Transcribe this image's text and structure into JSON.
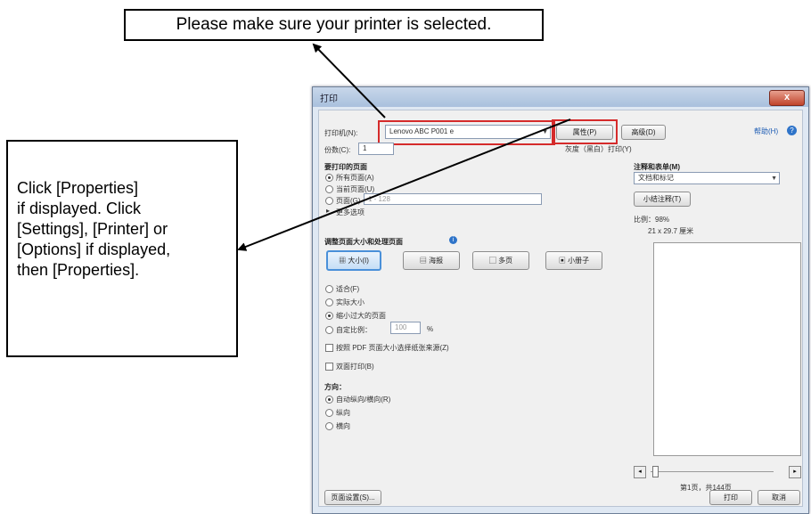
{
  "callouts": {
    "top": "Please make sure your printer is selected.",
    "left_lines": [
      "Click [Properties]",
      "if displayed. Click",
      "[Settings], [Printer] or",
      "[Options] if displayed,",
      "then [Properties]."
    ]
  },
  "dialog": {
    "title": "打印",
    "close_label": "x",
    "printer_label": "打印机(N):",
    "printer_value": "Lenovo ABC P001 e",
    "properties_button": "属性(P)",
    "advanced_button": "高级(D)",
    "help_link": "帮助(H)",
    "copies_label": "份数(C):",
    "copies_value": "1",
    "grayscale_label": "灰度（黑白）打印(Y)",
    "pages_section": "要打印的页面",
    "pages_options": [
      "所有页面(A)",
      "当前页面(U)",
      "页面(G)",
      "更多选项"
    ],
    "pages_range": "1 - 128",
    "size_section": "调整页面大小和处理页面",
    "mode_buttons": [
      "大小(I)",
      "海报",
      "多页",
      "小册子"
    ],
    "size_options": [
      "适合(F)",
      "实际大小",
      "缩小过大的页面",
      "自定比例："
    ],
    "scale_value": "100",
    "scale_unit": "%",
    "pdf_paper_check": "按照 PDF 页面大小选择纸张来源(Z)",
    "duplex_check": "双面打印(B)",
    "orientation_label": "方向：",
    "orientation_options": [
      "自动纵向/横向(R)",
      "纵向",
      "横向"
    ],
    "comments_label": "注释和表单(M)",
    "comments_value": "文档和标记",
    "summary_button": "小结注释(T)",
    "scale_text": "比例：98%",
    "size_text": "21 x 29.7 厘米",
    "page_counter": "第1页，共144页",
    "page_setup_button": "页面设置(S)...",
    "print_button": "打印",
    "cancel_button": "取消"
  }
}
